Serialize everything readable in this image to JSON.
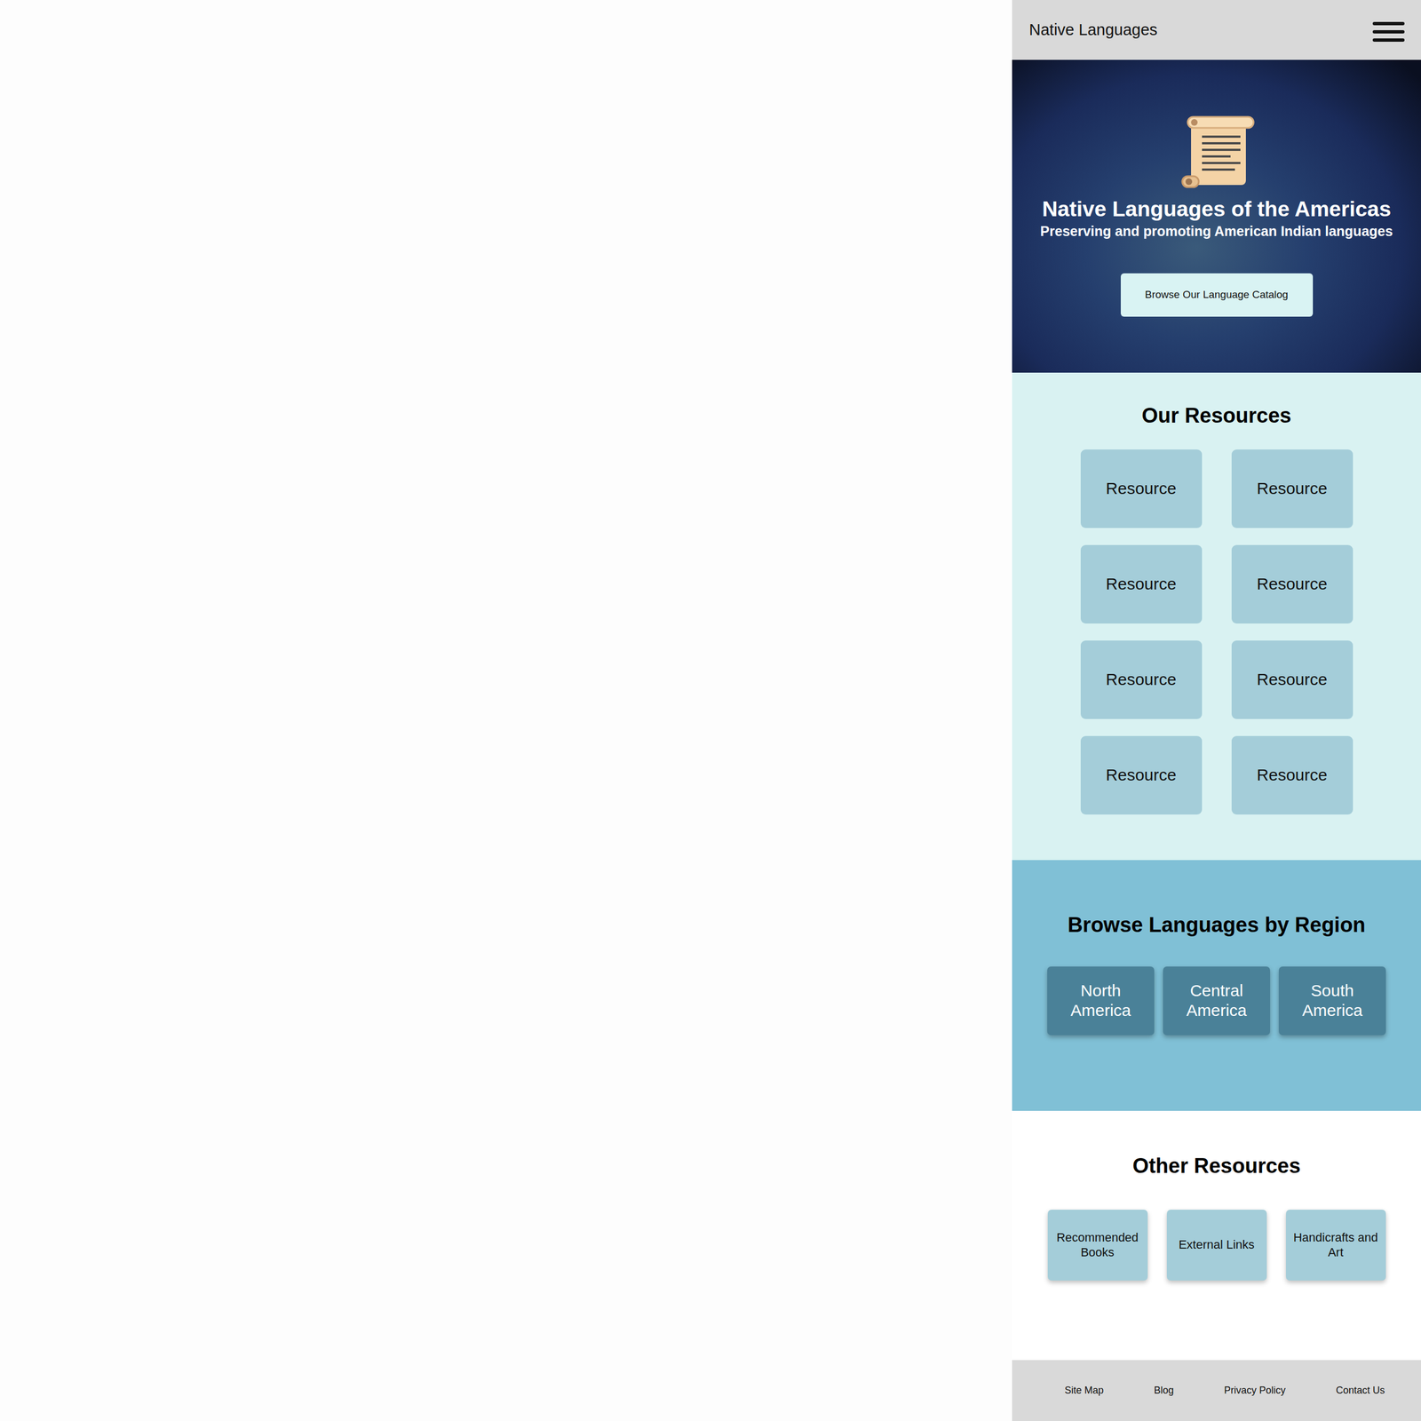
{
  "header": {
    "title": "Native Languages"
  },
  "hero": {
    "title": "Native Languages of the Americas",
    "subtitle": "Preserving and promoting American Indian languages",
    "button": "Browse Our Language Catalog"
  },
  "resources": {
    "heading": "Our Resources",
    "items": [
      "Resource",
      "Resource",
      "Resource",
      "Resource",
      "Resource",
      "Resource",
      "Resource",
      "Resource"
    ]
  },
  "regions": {
    "heading": "Browse Languages by Region",
    "items": [
      "North America",
      "Central America",
      "South America"
    ]
  },
  "other": {
    "heading": "Other Resources",
    "items": [
      "Recommended Books",
      "External Links",
      "Handicrafts and Art"
    ]
  },
  "footer": {
    "links": [
      "Site Map",
      "Blog",
      "Privacy Policy",
      "Contact Us"
    ]
  }
}
